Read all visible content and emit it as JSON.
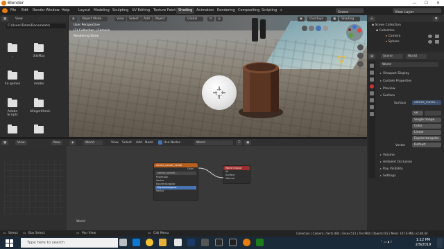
{
  "window": {
    "title": "Blender",
    "min": "—",
    "max": "☐",
    "close": "✕"
  },
  "menu": [
    "File",
    "Edit",
    "Render",
    "Window",
    "Help"
  ],
  "workspaces": [
    "Layout",
    "Modeling",
    "Sculpting",
    "UV Editing",
    "Texture Paint",
    "Shading",
    "Animation",
    "Rendering",
    "Compositing",
    "Scripting"
  ],
  "active_workspace": "Shading",
  "scene": {
    "name": "Scene",
    "view_layer": "View Layer"
  },
  "file_browser": {
    "view_label": "View",
    "path": "C:\\Users\\Tohm\\Documents\\",
    "items": [
      {
        "name": "..",
        "icon": "parent-folder-icon"
      },
      {
        "name": "3dsMax",
        "icon": "folder-icon"
      },
      {
        "name": "4a games",
        "icon": "folder-icon"
      },
      {
        "name": "Adobe",
        "icon": "folder-icon"
      },
      {
        "name": "Adobe Scripts",
        "icon": "folder-icon"
      },
      {
        "name": "Allegorithmic",
        "icon": "folder-icon"
      },
      {
        "name": "",
        "icon": "folder-icon"
      },
      {
        "name": "",
        "icon": "folder-icon"
      }
    ]
  },
  "viewport": {
    "mode": "Object Mode",
    "menus": [
      "View",
      "Select",
      "Add",
      "Object"
    ],
    "orientation": "Global",
    "overlays": "Overlays",
    "shading": "Shading",
    "info_lines": [
      "User Perspective",
      "(1) Collection | Camera",
      "Rendering Done"
    ]
  },
  "outliner": {
    "rows": [
      "Scene Collection",
      "Collection",
      "Camera",
      "Sphere"
    ]
  },
  "properties": {
    "tabs": [
      "Scene",
      "World"
    ],
    "world_name": "World",
    "sections": [
      "Viewport Display",
      "Custom Properties",
      "Preview",
      "Surface"
    ],
    "surface_label": "Surface",
    "surface_value": "venice_sunse...",
    "image_name": "ve",
    "source": "Single Image",
    "color": "Color",
    "interp": "Linear",
    "projection": "Equirectangular",
    "vector_label": "Vector",
    "vector_value": "Default",
    "lower_sections": [
      "Volume",
      "Ambient Occlusion",
      "Ray Visibility",
      "Settings"
    ]
  },
  "node_editor": {
    "left_view": "View",
    "new_label": "New",
    "world_dropdown": "World",
    "menus": [
      "View",
      "Select",
      "Add",
      "Node"
    ],
    "use_nodes": "Use Nodes",
    "world_field": "World",
    "corner_label": "World",
    "env_node": {
      "title": "venice_sunset_1k.hdr",
      "rows": [
        "Color",
        "venice_sunset...",
        "Projection",
        "Vector",
        "Equirectangular",
        "Equirectangular",
        "Vector"
      ]
    },
    "out_node": {
      "title": "World Output",
      "rows": [
        "All",
        "Surface",
        "Volume"
      ]
    }
  },
  "status": {
    "select": "Select",
    "box_select": "Box Select",
    "pan_view": "Pan View",
    "call_menu": "Call Menu",
    "info": "Collection | Camera | Verts:482 | Faces:512 | Tris:960 | Objects:0/2 | Mem: 107.6 MB | v2.80.44"
  },
  "taskbar": {
    "search_placeholder": "Type here to search",
    "time": "1:12 PM",
    "date": "2/9/2019"
  },
  "colors": {
    "blender_orange": "#e87d0d",
    "texture_node_header": "#b85f1e",
    "output_node_header": "#9a2f2f",
    "accent_blue": "#4772b3"
  }
}
